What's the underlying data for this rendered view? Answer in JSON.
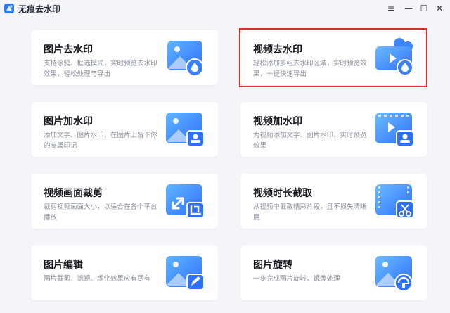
{
  "app": {
    "title": "无痕去水印"
  },
  "window": {
    "menu_icon": "≡",
    "minimize_icon": "—",
    "maximize_icon": "☐",
    "close_icon": "✕"
  },
  "cards": [
    {
      "title": "图片去水印",
      "desc": "支持涂鸦、框选模式，实时预览去水印效果，轻松处理与导出",
      "icon": "image-remove-watermark-icon"
    },
    {
      "title": "视频去水印",
      "desc": "轻松添加多组去水印区域，实时预览效果，一键快速导出",
      "icon": "video-remove-watermark-icon"
    },
    {
      "title": "图片加水印",
      "desc": "添加文字、图片水印，在图片上留下你的专属印记",
      "icon": "image-add-watermark-icon"
    },
    {
      "title": "视频加水印",
      "desc": "为视频添加文字、图片水印，实时预览效果",
      "icon": "video-add-watermark-icon"
    },
    {
      "title": "视频画面裁剪",
      "desc": "裁剪视频画面大小，以适合在各个平台播放",
      "icon": "video-crop-icon"
    },
    {
      "title": "视频时长截取",
      "desc": "从视频中截取精彩片段，且不损失清晰度",
      "icon": "video-trim-icon"
    },
    {
      "title": "图片编辑",
      "desc": "图片裁剪、滤镜、虚化效果应有尽有",
      "icon": "image-edit-icon"
    },
    {
      "title": "图片旋转",
      "desc": "一步完成图片旋转、镜像处理",
      "icon": "image-rotate-icon"
    }
  ]
}
